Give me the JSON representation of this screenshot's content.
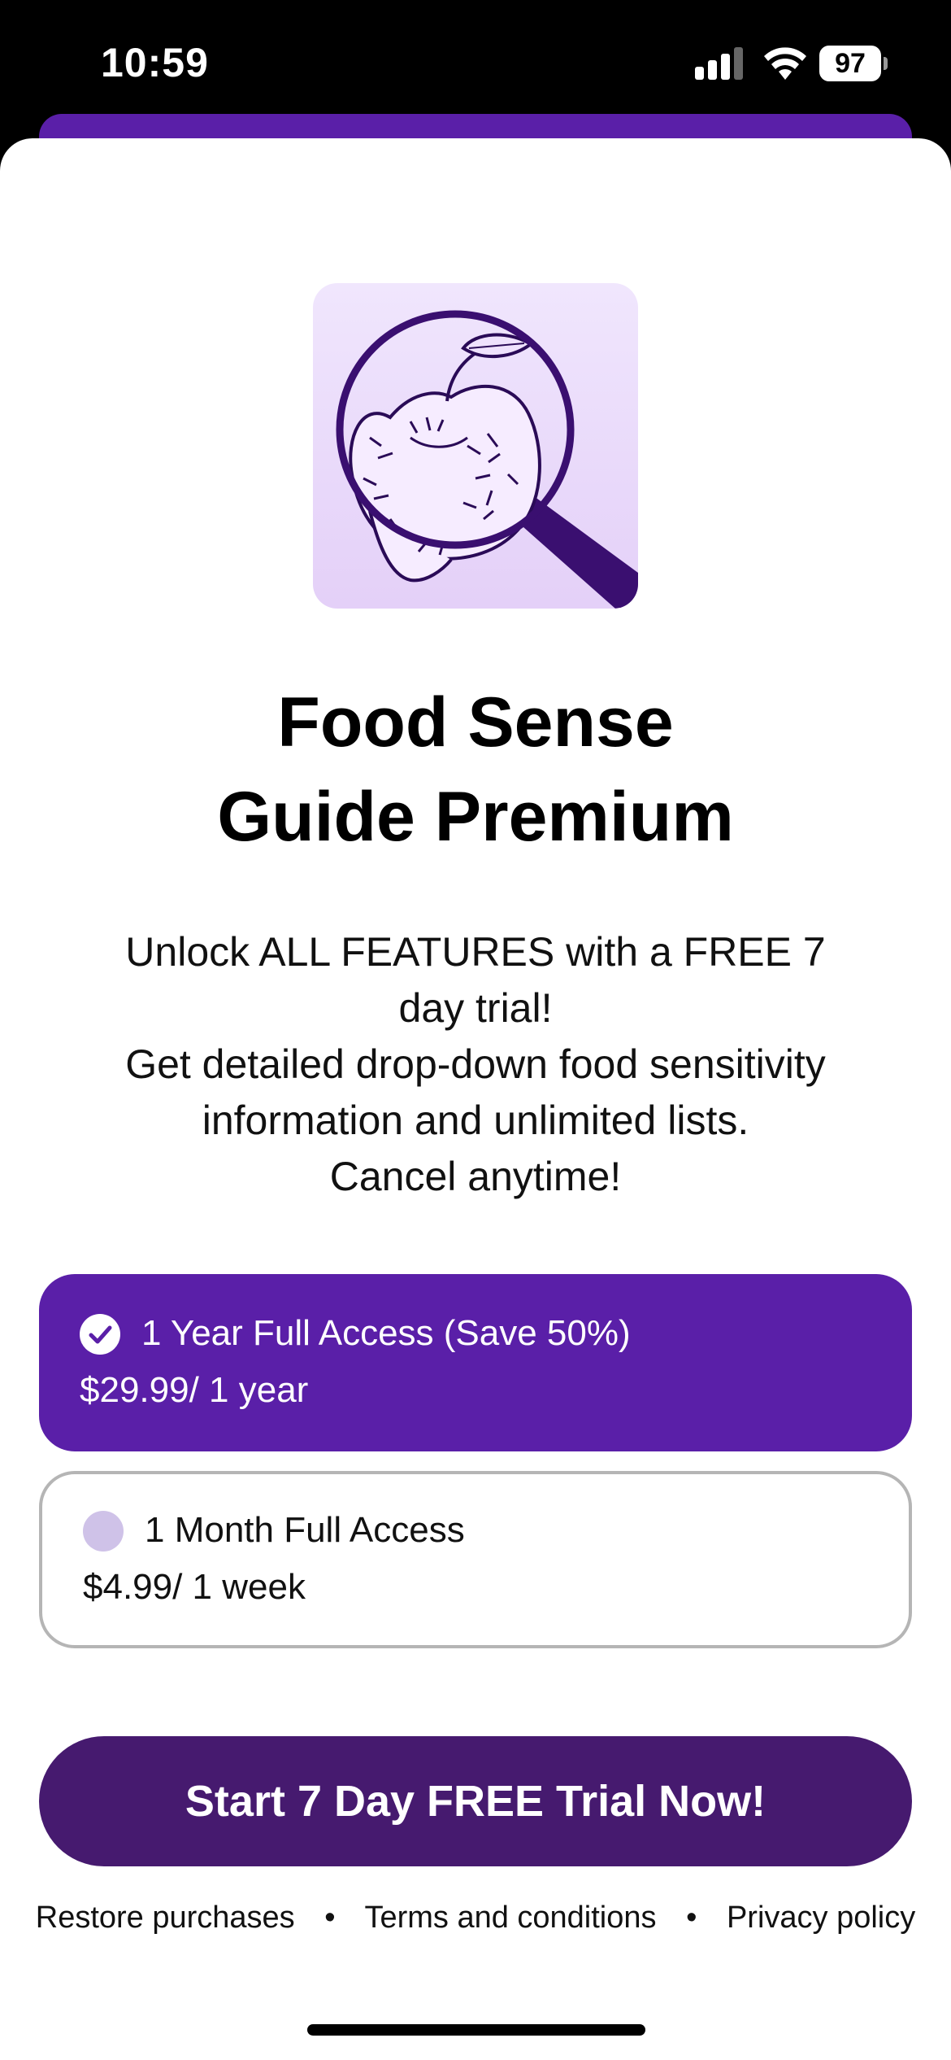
{
  "status_bar": {
    "time": "10:59",
    "battery": "97"
  },
  "paywall": {
    "title_line1": "Food Sense",
    "title_line2": "Guide Premium",
    "description": [
      "Unlock ALL FEATURES with a FREE 7",
      "day trial!",
      "Get detailed drop-down food sensitivity",
      "information and unlimited lists.",
      "Cancel anytime!"
    ],
    "plans": [
      {
        "label": "1 Year Full Access (Save 50%)",
        "price": "$29.99/ 1 year",
        "selected": true
      },
      {
        "label": "1 Month Full Access",
        "price": "$4.99/ 1 week",
        "selected": false
      }
    ],
    "cta_label": "Start 7 Day FREE Trial Now!",
    "footer": {
      "restore": "Restore purchases",
      "separator": "•",
      "terms": "Terms and conditions",
      "privacy": "Privacy policy"
    }
  },
  "colors": {
    "accent": "#5a1fa8",
    "cta": "#461a6f",
    "icon_bg": "#eadbfa",
    "unselected_radio": "#cfc2e8"
  }
}
